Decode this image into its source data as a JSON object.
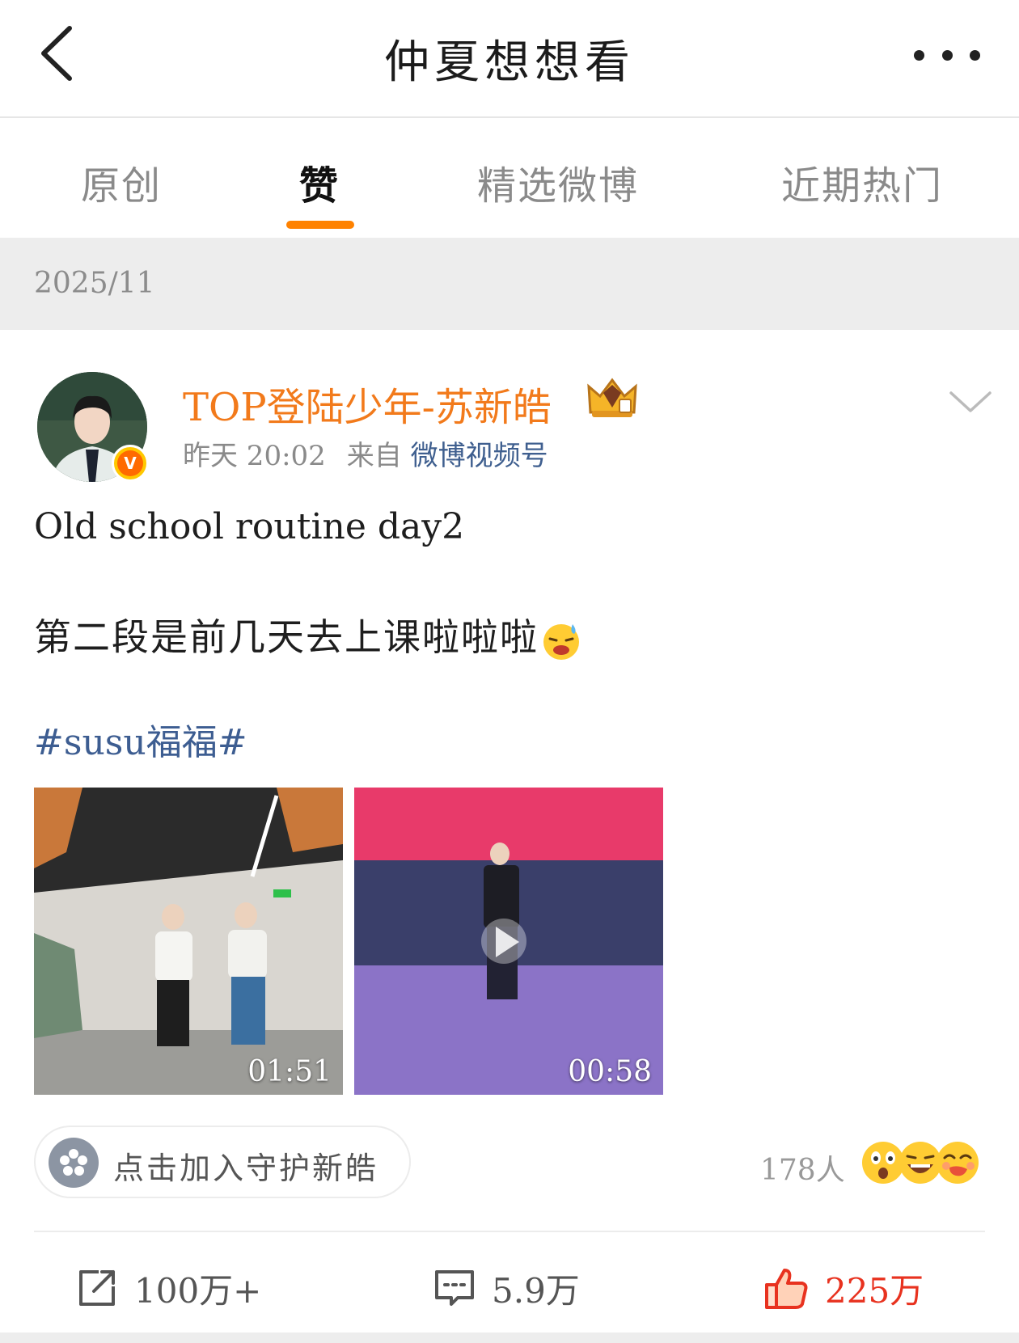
{
  "header": {
    "title": "仲夏想想看"
  },
  "tabs": [
    {
      "label": "原创"
    },
    {
      "label": "赞"
    },
    {
      "label": "精选微博"
    },
    {
      "label": "近期热门"
    }
  ],
  "active_tab": "赞",
  "date_group": "2025/11",
  "post": {
    "author": "TOP登陆少年-苏新皓",
    "time": "昨天 20:02",
    "source_prefix": "来自",
    "source": "微博视频号",
    "text_line1": "Old school routine day2",
    "text_line2": "第二段是前几天去上课啦啦啦",
    "hashtag": "#susu福福#",
    "videos": [
      {
        "duration": "01:51"
      },
      {
        "duration": "00:58"
      }
    ],
    "guard_button": "点击加入守护新皓",
    "reactors": "178人",
    "actions": {
      "share": "100万+",
      "comment": "5.9万",
      "like": "225万"
    }
  },
  "colors": {
    "accent": "#ff8200",
    "username": "#f27a1b",
    "link": "#3d5d91",
    "like": "#e8321f"
  }
}
